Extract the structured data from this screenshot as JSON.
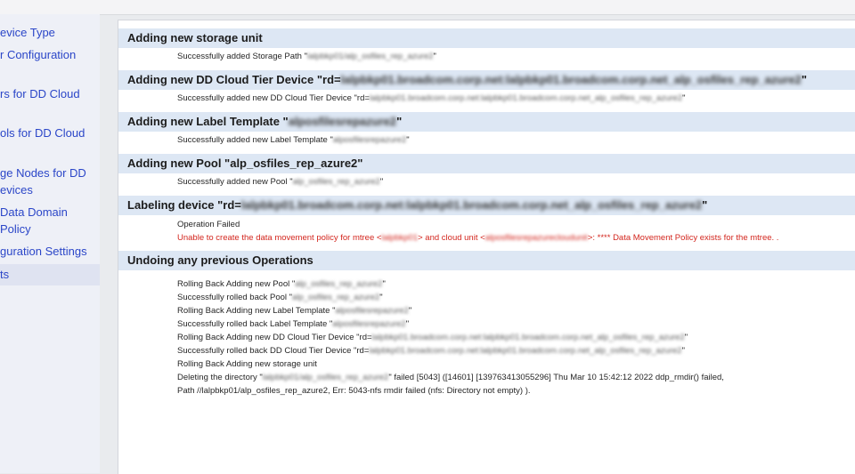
{
  "sidebar": {
    "items": [
      {
        "label": "evice Type"
      },
      {
        "label": "r Configuration"
      },
      {
        "label": "rs for DD Cloud"
      },
      {
        "label": "ols for DD Cloud"
      },
      {
        "label_line1": "ge Nodes for DD",
        "label_line2": "evices"
      },
      {
        "label_line1": " Data Domain",
        "label_line2": " Policy"
      },
      {
        "label": "guration Settings"
      },
      {
        "label": "ts"
      }
    ]
  },
  "sections": {
    "storage_unit": {
      "heading": "Adding new storage unit",
      "line_prefix": "Successfully added Storage Path \"",
      "line_blur": "lalpbkp01/alp_osfiles_rep_azure2",
      "line_suffix": "\""
    },
    "cloud_tier": {
      "heading_prefix": "Adding new DD Cloud Tier Device \"rd=",
      "heading_blur": "lalpbkp01.broadcom.corp.net:lalpbkp01.broadcom.corp.net_alp_osfiles_rep_azure2",
      "heading_suffix": "\"",
      "line_prefix": "Successfully added new DD Cloud Tier Device \"rd=",
      "line_blur": "lalpbkp01.broadcom.corp.net:lalpbkp01.broadcom.corp.net_alp_osfiles_rep_azure2",
      "line_suffix": "\""
    },
    "label_template": {
      "heading_prefix": "Adding new Label Template \"",
      "heading_blur": "alposfilesrepazure2",
      "heading_suffix": "\"",
      "line_prefix": "Successfully added new Label Template \"",
      "line_blur": "alposfilesrepazure2",
      "line_suffix": "\""
    },
    "pool": {
      "heading": "Adding new Pool \"alp_osfiles_rep_azure2\"",
      "line_prefix": "Successfully added new Pool \"",
      "line_blur": "alp_osfiles_rep_azure2",
      "line_suffix": "\""
    },
    "labeling": {
      "heading_prefix": "Labeling device \"rd=",
      "heading_blur": "lalpbkp01.broadcom.corp.net:lalpbkp01.broadcom.corp.net_alp_osfiles_rep_azure2",
      "heading_suffix": "\"",
      "status": "Operation Failed",
      "error_part1": "Unable to create the data movement policy for mtree <",
      "error_blur1": "lalpbkp01",
      "error_part2": "> and cloud unit <",
      "error_blur2": "alposfilesrepazurecloudunit",
      "error_part3": ">: **** Data Movement Policy exists for the mtree. ."
    },
    "undo": {
      "heading": "Undoing any previous Operations",
      "l1_prefix": "Rolling Back Adding new Pool \"",
      "l1_blur": "alp_osfiles_rep_azure2",
      "l1_suffix": "\"",
      "l2_prefix": "Successfully rolled back Pool \"",
      "l2_blur": "alp_osfiles_rep_azure2",
      "l2_suffix": "\"",
      "l3_prefix": "Rolling Back Adding new Label Template \"",
      "l3_blur": "alposfilesrepazure2",
      "l3_suffix": "\"",
      "l4_prefix": "Successfully rolled back Label Template \"",
      "l4_blur": "alposfilesrepazure2",
      "l4_suffix": "\"",
      "l5_prefix": "Rolling Back Adding new DD Cloud Tier Device \"rd=",
      "l5_blur": "lalpbkp01.broadcom.corp.net:lalpbkp01.broadcom.corp.net_alp_osfiles_rep_azure2",
      "l5_suffix": "\"",
      "l6_prefix": "Successfully rolled back DD Cloud Tier Device \"rd=",
      "l6_blur": "lalpbkp01.broadcom.corp.net:lalpbkp01.broadcom.corp.net_alp_osfiles_rep_azure2",
      "l6_suffix": "\"",
      "l7": "Rolling Back Adding new storage unit",
      "l8_prefix": "Deleting the directory \"",
      "l8_blur": "lalpbkp01/alp_osfiles_rep_azure2",
      "l8_suffix": "\" failed [5043] ([14601] [139763413055296] Thu Mar 10 15:42:12 2022 ddp_rmdir() failed,",
      "l9": "Path //lalpbkp01/alp_osfiles_rep_azure2, Err: 5043-nfs rmdir failed (nfs: Directory not empty) )."
    }
  }
}
